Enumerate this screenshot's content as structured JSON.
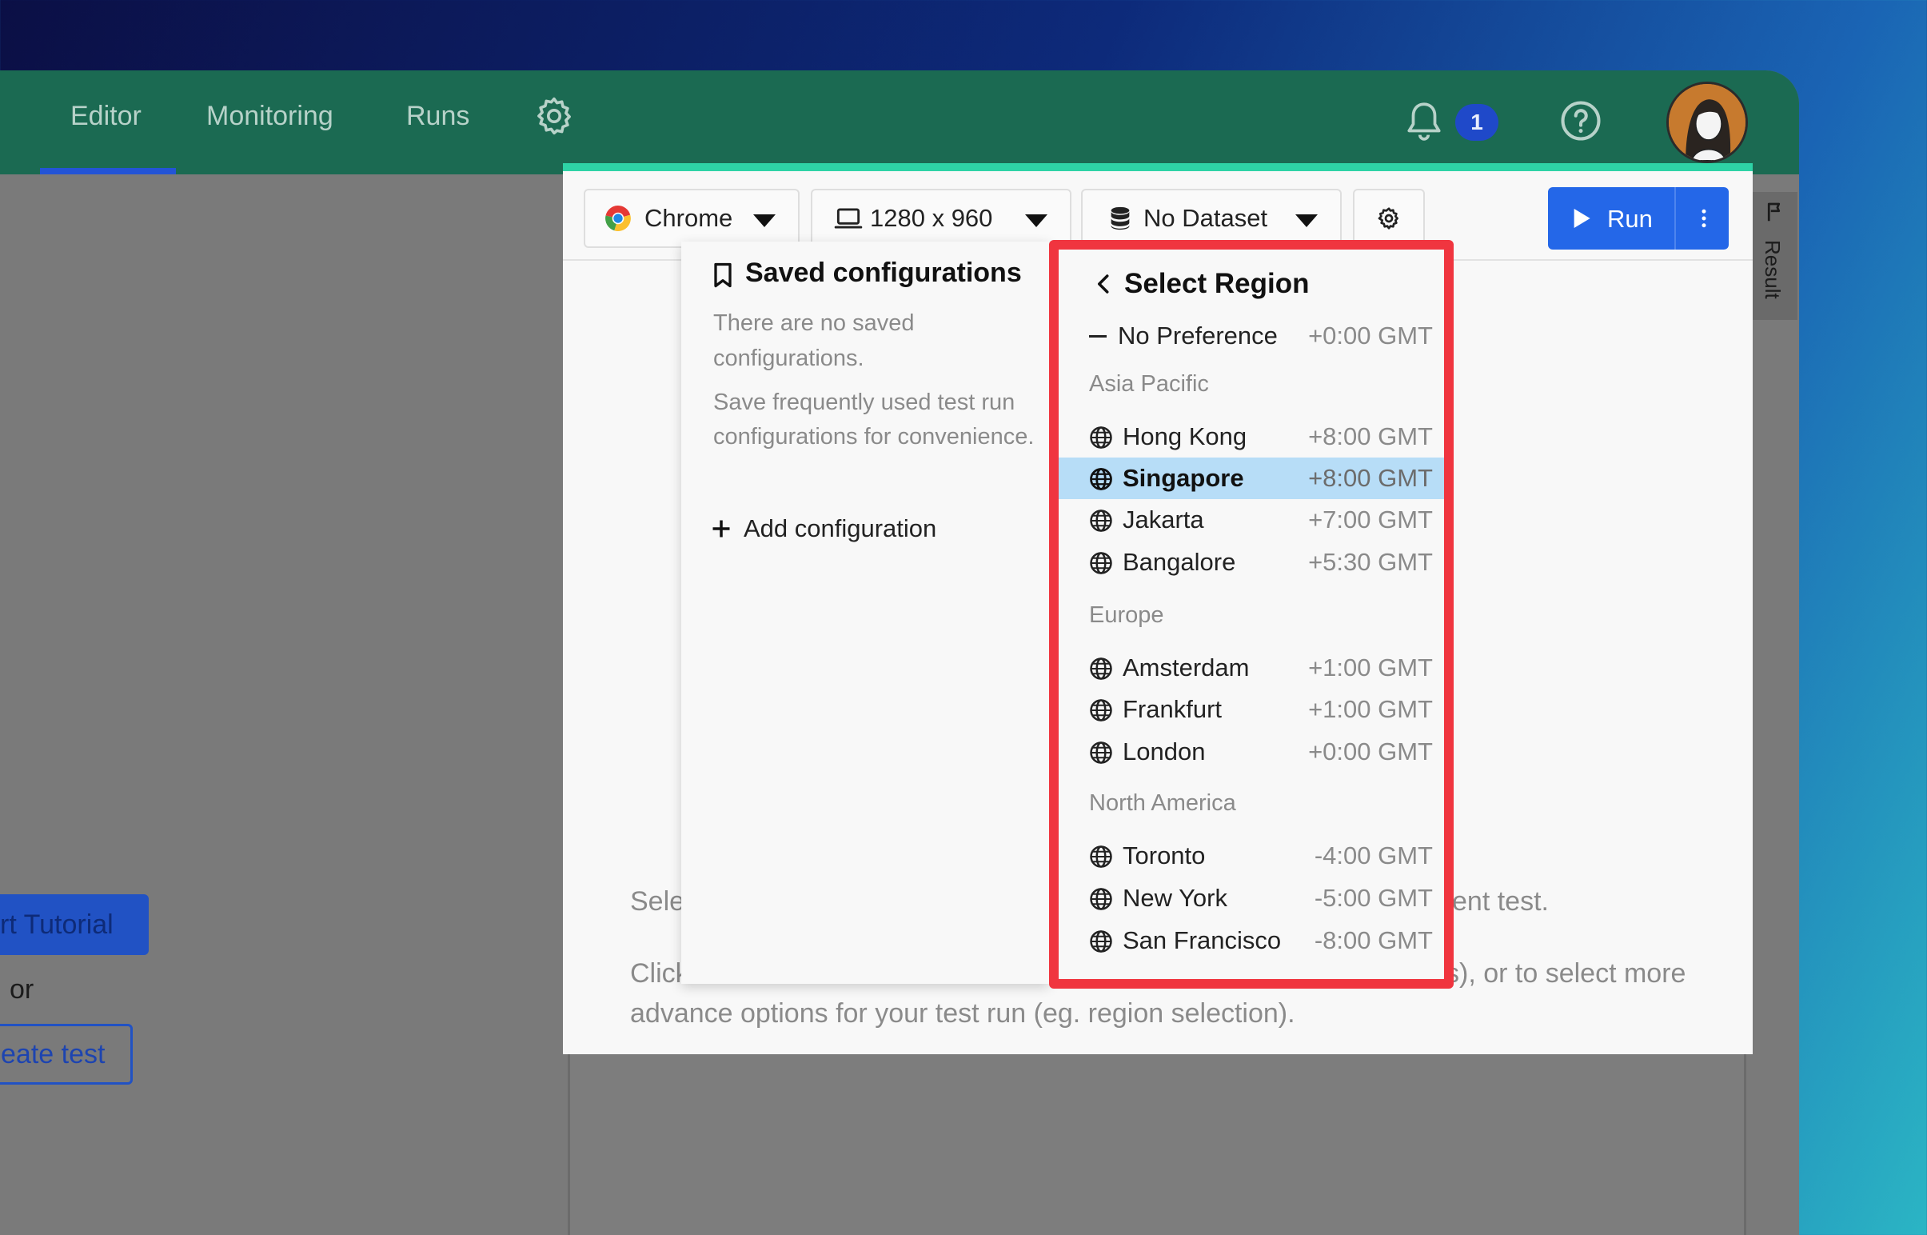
{
  "nav": {
    "tabs": [
      {
        "label": "Editor"
      },
      {
        "label": "Monitoring"
      },
      {
        "label": "Runs"
      }
    ],
    "notification_count": "1"
  },
  "left": {
    "tutorial_label": "rt Tutorial",
    "or_label": "or",
    "create_label": "eate test"
  },
  "side_tab": {
    "label": "Result"
  },
  "toolbar": {
    "browser": "Chrome",
    "resolution": "1280 x 960",
    "dataset": "No Dataset",
    "run_label": "Run"
  },
  "saved": {
    "title": "Saved configurations",
    "empty_text": "There are no saved configurations.",
    "help_text": "Save frequently used test run configurations for convenience.",
    "add_label": "Add configuration"
  },
  "region": {
    "title": "Select Region",
    "no_pref": {
      "name": "No Preference",
      "tz": "+0:00 GMT"
    },
    "groups": [
      {
        "name": "Asia Pacific",
        "items": [
          {
            "name": "Hong Kong",
            "tz": "+8:00 GMT"
          },
          {
            "name": "Singapore",
            "tz": "+8:00 GMT",
            "selected": true
          },
          {
            "name": "Jakarta",
            "tz": "+7:00 GMT"
          },
          {
            "name": "Bangalore",
            "tz": "+5:30 GMT"
          }
        ]
      },
      {
        "name": "Europe",
        "items": [
          {
            "name": "Amsterdam",
            "tz": "+1:00 GMT"
          },
          {
            "name": "Frankfurt",
            "tz": "+1:00 GMT"
          },
          {
            "name": "London",
            "tz": "+0:00 GMT"
          }
        ]
      },
      {
        "name": "North America",
        "items": [
          {
            "name": "Toronto",
            "tz": "-4:00 GMT"
          },
          {
            "name": "New York",
            "tz": "-5:00 GMT"
          },
          {
            "name": "San Francisco",
            "tz": "-8:00 GMT"
          }
        ]
      }
    ]
  },
  "background_text": {
    "line1_start": "Sele",
    "line1_end": "ent test.",
    "line2_start": "Click",
    "line2_end": "s), or to select more",
    "line3": "advance options for your test run (eg. region selection)."
  },
  "colors": {
    "topbar": "#1b6a52",
    "accent": "#2ed3a6",
    "run": "#2467e8",
    "highlight": "#f0353f",
    "selected_row": "#b7ddf7"
  }
}
